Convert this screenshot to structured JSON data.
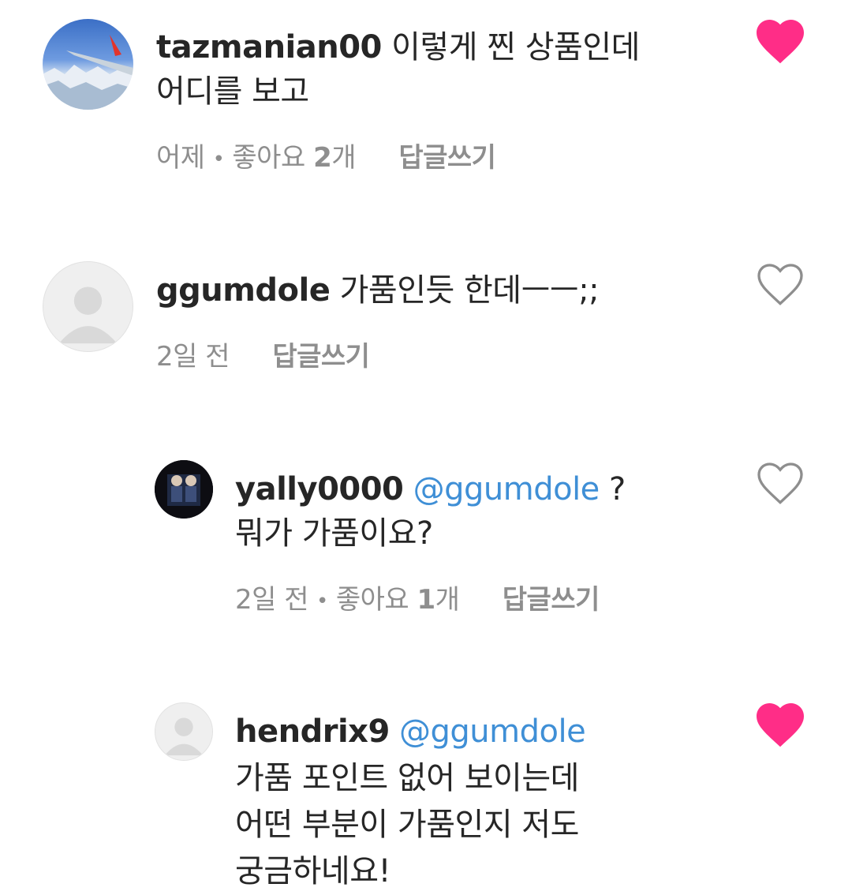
{
  "comments": [
    {
      "username": "tazmanian00",
      "text_line1": "이렇게 찐 상품인데",
      "text_line2": "어디를 보고",
      "time": "어제",
      "likes_label": "좋아요",
      "likes_count": "2",
      "likes_unit": "개",
      "reply_label": "답글쓰기",
      "liked": true
    },
    {
      "username": "ggumdole",
      "text_line1": "가품인듯 한데ㅡㅡ;;",
      "time": "2일 전",
      "reply_label": "답글쓰기",
      "liked": false
    },
    {
      "username": "yally0000",
      "mention": "@ggumdole",
      "text_line1_suffix": "?",
      "text_line2": "뭐가 가품이요?",
      "time": "2일 전",
      "likes_label": "좋아요",
      "likes_count": "1",
      "likes_unit": "개",
      "reply_label": "답글쓰기",
      "liked": false
    },
    {
      "username": "hendrix9",
      "mention": "@ggumdole",
      "text_line2": "가품 포인트 없어 보이는데",
      "text_line3": "어떤 부분이 가품인지 저도",
      "text_line4": "궁금하네요!",
      "liked": true
    }
  ],
  "colors": {
    "liked_heart": "#ff2d87",
    "mention": "#3f8fd6",
    "meta": "#8e8e8e"
  }
}
